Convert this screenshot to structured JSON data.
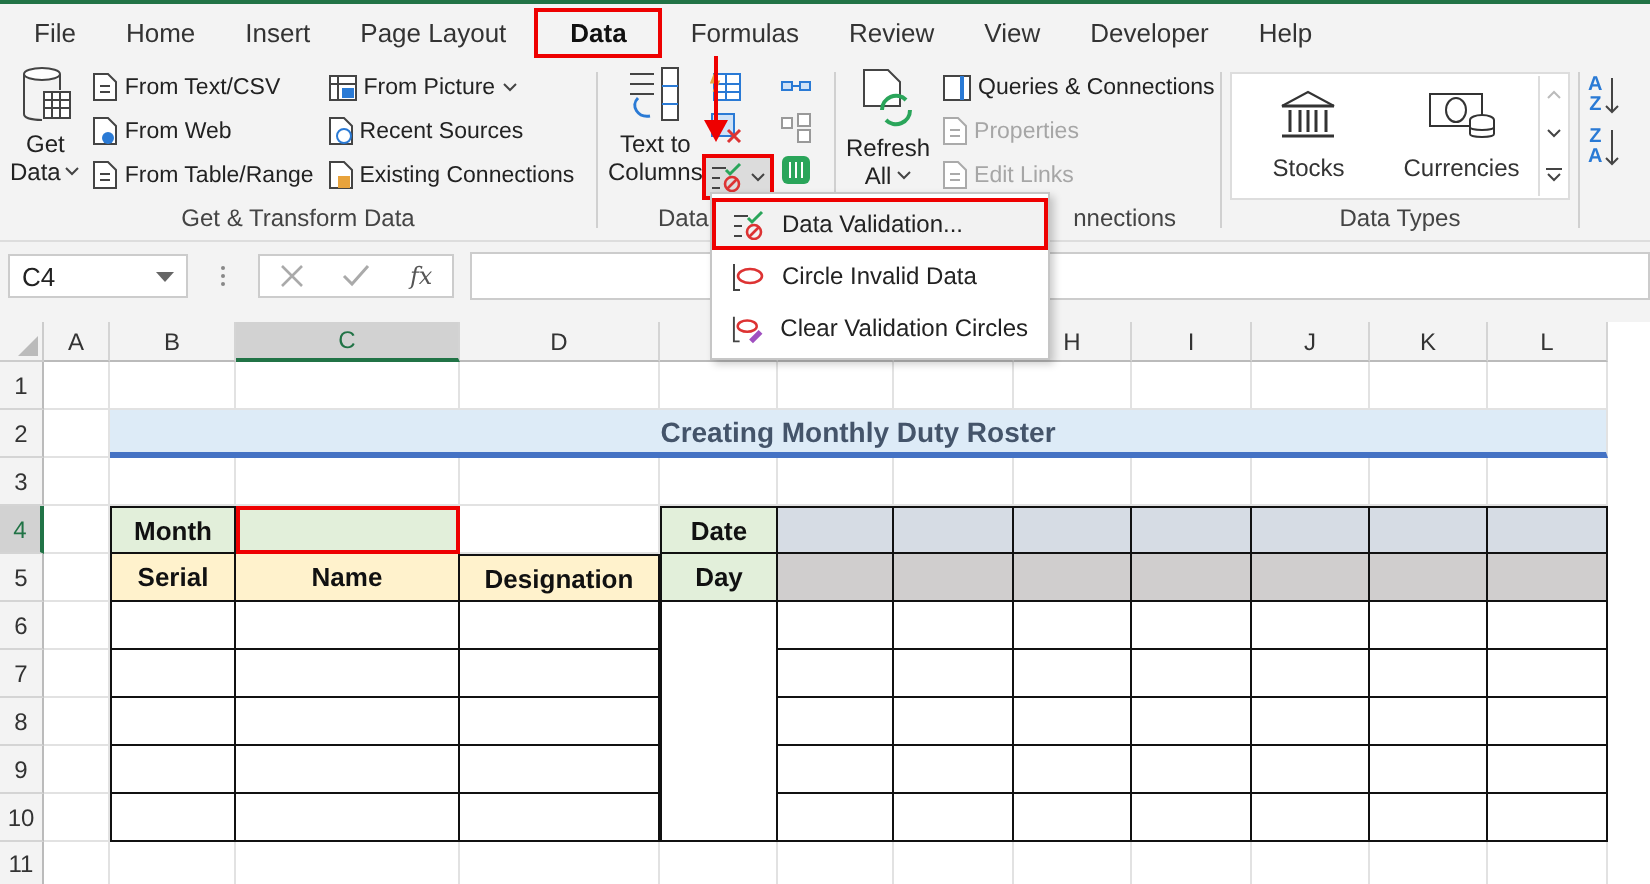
{
  "tabs": [
    {
      "label": "File",
      "selected": false,
      "highlighted": false
    },
    {
      "label": "Home",
      "selected": false,
      "highlighted": false
    },
    {
      "label": "Insert",
      "selected": false,
      "highlighted": false
    },
    {
      "label": "Page Layout",
      "selected": false,
      "highlighted": false
    },
    {
      "label": "Data",
      "selected": true,
      "highlighted": true
    },
    {
      "label": "Formulas",
      "selected": false,
      "highlighted": false
    },
    {
      "label": "Review",
      "selected": false,
      "highlighted": false
    },
    {
      "label": "View",
      "selected": false,
      "highlighted": false
    },
    {
      "label": "Developer",
      "selected": false,
      "highlighted": false
    },
    {
      "label": "Help",
      "selected": false,
      "highlighted": false
    }
  ],
  "ribbon": {
    "get_group": {
      "label": "Get & Transform Data",
      "get_data": {
        "lines": [
          "Get",
          "Data"
        ]
      },
      "items": [
        {
          "label": "From Text/CSV",
          "dropdown": false
        },
        {
          "label": "From Web",
          "dropdown": false
        },
        {
          "label": "From Table/Range",
          "dropdown": false
        },
        {
          "label": "From Picture",
          "dropdown": true
        },
        {
          "label": "Recent Sources",
          "dropdown": false
        },
        {
          "label": "Existing Connections",
          "dropdown": false
        }
      ]
    },
    "tools_group": {
      "label": "Data",
      "text_to_columns": {
        "lines": [
          "Text to",
          "Columns"
        ]
      },
      "validation_button": {
        "highlighted": true
      }
    },
    "queries_group": {
      "label": "nnections",
      "refresh": {
        "lines": [
          "Refresh",
          "All"
        ]
      },
      "items": [
        {
          "label": "Queries & Connections",
          "disabled": false
        },
        {
          "label": "Properties",
          "disabled": true
        },
        {
          "label": "Edit Links",
          "disabled": true
        }
      ]
    },
    "types_group": {
      "label": "Data Types",
      "items": [
        {
          "label": "Stocks"
        },
        {
          "label": "Currencies"
        }
      ]
    },
    "sort": [
      {
        "top": "A",
        "bottom": "Z"
      },
      {
        "top": "Z",
        "bottom": "A"
      }
    ]
  },
  "menu": {
    "items": [
      {
        "label": "Data Validation...",
        "highlighted": true
      },
      {
        "label": "Circle Invalid Data",
        "highlighted": false
      },
      {
        "label": "Clear Validation Circles",
        "highlighted": false
      }
    ]
  },
  "formula_bar": {
    "name_box": "C4",
    "fx": "fx"
  },
  "sheet": {
    "columns": [
      {
        "label": "A",
        "selected": false
      },
      {
        "label": "B",
        "selected": false
      },
      {
        "label": "C",
        "selected": true
      },
      {
        "label": "D",
        "selected": false
      },
      {
        "selected": false
      },
      {
        "selected": false
      },
      {
        "selected": false
      },
      {
        "label": "H",
        "selected": false
      },
      {
        "label": "I",
        "selected": false
      },
      {
        "label": "J",
        "selected": false
      },
      {
        "label": "K",
        "selected": false
      },
      {
        "label": "L",
        "selected": false
      }
    ],
    "rows": [
      {
        "label": "1",
        "selected": false
      },
      {
        "label": "2",
        "selected": false
      },
      {
        "label": "3",
        "selected": false
      },
      {
        "label": "4",
        "selected": true
      },
      {
        "label": "5",
        "selected": false
      },
      {
        "label": "6",
        "selected": false
      },
      {
        "label": "7",
        "selected": false
      },
      {
        "label": "8",
        "selected": false
      },
      {
        "label": "9",
        "selected": false
      },
      {
        "label": "10",
        "selected": false
      },
      {
        "label": "11",
        "selected": false
      }
    ]
  },
  "roster": {
    "title": "Creating Monthly Duty Roster",
    "month_label": "Month",
    "month_value_highlighted": true,
    "date_label": "Date",
    "day_label": "Day",
    "headers": [
      "Serial",
      "Name",
      "Designation"
    ]
  }
}
